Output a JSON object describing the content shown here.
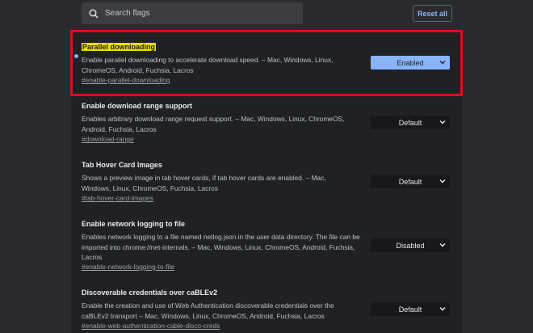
{
  "search": {
    "placeholder": "Search flags"
  },
  "reset_label": "Reset all",
  "flags": [
    {
      "title": "Parallel downloading",
      "desc": "Enable parallel downloading to accelerate download speed. – Mac, Windows, Linux, ChromeOS, Android, Fuchsia, Lacros",
      "link": "#enable-parallel-downloading",
      "state": "Enabled"
    },
    {
      "title": "Enable download range support",
      "desc": "Enables arbitrary download range request support. – Mac, Windows, Linux, ChromeOS, Android, Fuchsia, Lacros",
      "link": "#download-range",
      "state": "Default"
    },
    {
      "title": "Tab Hover Card Images",
      "desc": "Shows a preview image in tab hover cards, if tab hover cards are enabled. – Mac, Windows, Linux, ChromeOS, Fuchsia, Lacros",
      "link": "#tab-hover-card-images",
      "state": "Default"
    },
    {
      "title": "Enable network logging to file",
      "desc": "Enables network logging to a file named netlog.json in the user data directory. The file can be imported into chrome://net-internals. – Mac, Windows, Linux, ChromeOS, Android, Fuchsia, Lacros",
      "link": "#enable-network-logging-to-file",
      "state": "Disabled"
    },
    {
      "title": "Discoverable credentials over caBLEv2",
      "desc": "Enable the creation and use of Web Authentication discoverable credentials over the caBLEv2 transport – Mac, Windows, Linux, ChromeOS, Android, Fuchsia, Lacros",
      "link": "#enable-web-authentication-cable-disco-creds",
      "state": "Default"
    }
  ],
  "colors": {
    "accent": "#8ab4f8",
    "highlight_border": "#d8101a",
    "title_highlight": "#e8e000"
  }
}
